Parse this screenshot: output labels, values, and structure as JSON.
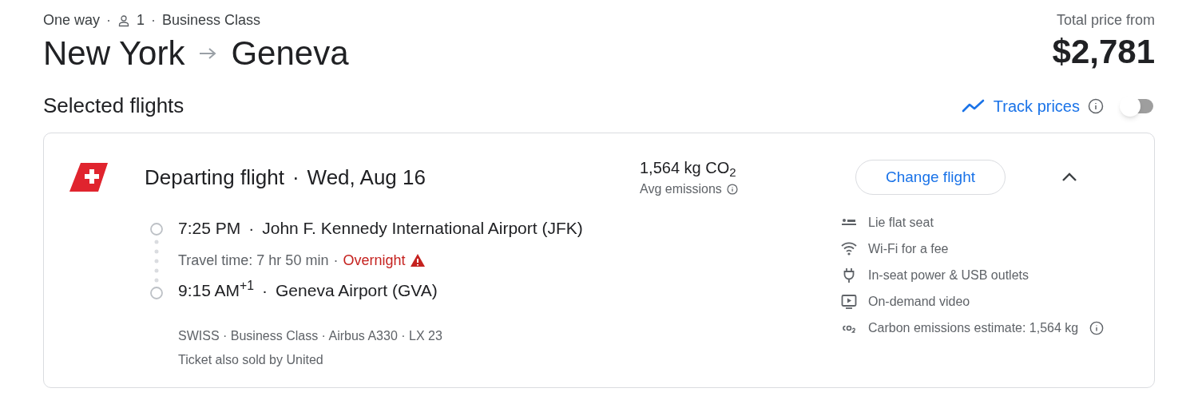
{
  "trip": {
    "type": "One way",
    "sep1": "·",
    "passengers": "1",
    "sep2": "·",
    "cabin": "Business Class"
  },
  "route": {
    "origin": "New York",
    "destination": "Geneva"
  },
  "price": {
    "label": "Total price from",
    "amount": "$2,781"
  },
  "section_title": "Selected flights",
  "track_prices": {
    "label": "Track prices",
    "on": false
  },
  "flight": {
    "title": "Departing flight",
    "title_sep": "·",
    "date": "Wed, Aug 16",
    "expanded": true,
    "emissions": "1,564 kg CO$_{2}$",
    "emissions_label": "Avg emissions",
    "change_button": "Change flight",
    "departure": {
      "time": "7:25 PM",
      "sep": "·",
      "airport": "John F. Kennedy International Airport (JFK)"
    },
    "travel_time": "Travel time: 7 hr 50 min",
    "travel_sep": "·",
    "warning": "Overnight",
    "arrival": {
      "time": "9:15 AM$^{+1}$",
      "sep": "·",
      "airport": "Geneva Airport (GVA)"
    },
    "details": "SWISS · Business Class · Airbus A330 · LX 23",
    "sold_by": "Ticket also sold by United",
    "amenities": [
      {
        "kind": "seat",
        "label": "Lie flat seat",
        "info": false
      },
      {
        "kind": "wifi",
        "label": "Wi-Fi for a fee",
        "info": false
      },
      {
        "kind": "power",
        "label": "In-seat power & USB outlets",
        "info": false
      },
      {
        "kind": "video",
        "label": "On-demand video",
        "info": false
      },
      {
        "kind": "co2",
        "label": "Carbon emissions estimate: 1,564 kg",
        "info": true
      }
    ]
  }
}
